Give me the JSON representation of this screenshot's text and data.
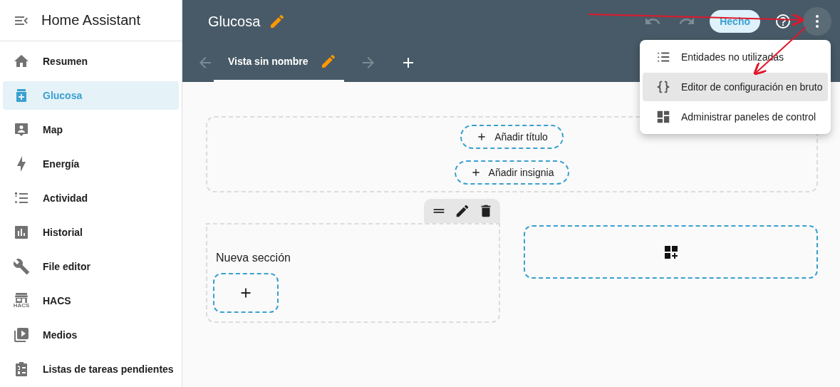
{
  "sidebar": {
    "title": "Home Assistant",
    "items": [
      {
        "label": "Resumen",
        "selected": false
      },
      {
        "label": "Glucosa",
        "selected": true
      },
      {
        "label": "Map",
        "selected": false
      },
      {
        "label": "Energía",
        "selected": false
      },
      {
        "label": "Actividad",
        "selected": false
      },
      {
        "label": "Historial",
        "selected": false
      },
      {
        "label": "File editor",
        "selected": false
      },
      {
        "label": "HACS",
        "selected": false,
        "icon_text": "HACS"
      },
      {
        "label": "Medios",
        "selected": false
      },
      {
        "label": "Listas de tareas pendientes",
        "selected": false
      }
    ]
  },
  "header": {
    "title": "Glucosa",
    "undo_disabled": true,
    "redo_disabled": true,
    "done_button": "Hecho"
  },
  "tabs": [
    {
      "label": "Vista sin nombre",
      "selected": true
    }
  ],
  "menu": {
    "items": [
      {
        "label": "Entidades no utilizadas",
        "selected": false
      },
      {
        "label": "Editor de configuración en bruto",
        "selected": true
      },
      {
        "label": "Administrar paneles de control",
        "selected": false
      }
    ]
  },
  "badges_area": {
    "buttons": [
      "Añadir título",
      "Añadir insignia"
    ]
  },
  "section": {
    "title": "Nueva sección"
  }
}
